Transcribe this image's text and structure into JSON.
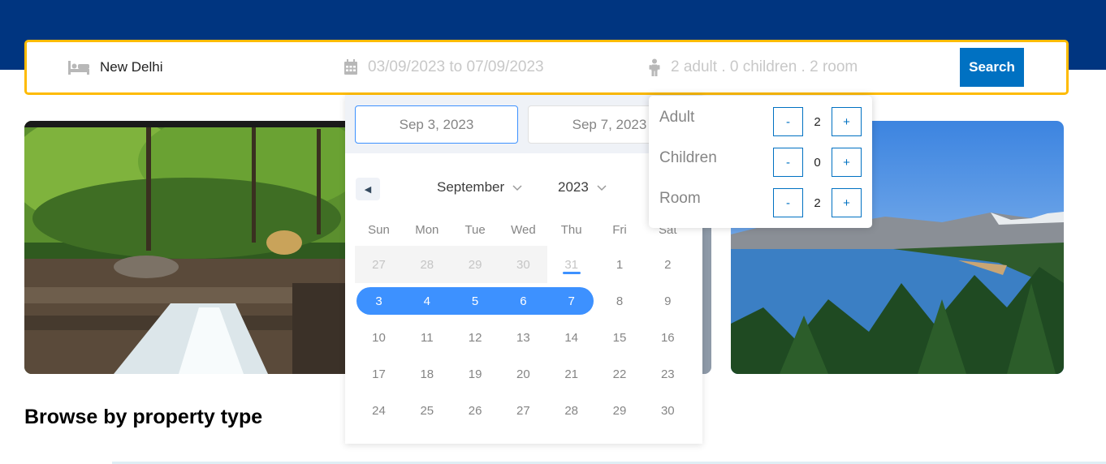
{
  "search": {
    "destination": "New Delhi",
    "dates": "03/09/2023 to 07/09/2023",
    "guests": "2 adult . 0 children . 2 room",
    "button": "Search"
  },
  "section_title": "Browse by property type",
  "datepicker": {
    "start_date": "Sep 3, 2023",
    "end_date": "Sep 7, 2023",
    "month": "September",
    "year": "2023",
    "weekdays": [
      "Sun",
      "Mon",
      "Tue",
      "Wed",
      "Thu",
      "Fri",
      "Sat"
    ],
    "weeks": [
      [
        "27",
        "28",
        "29",
        "30",
        "31",
        "1",
        "2"
      ],
      [
        "3",
        "4",
        "5",
        "6",
        "7",
        "8",
        "9"
      ],
      [
        "10",
        "11",
        "12",
        "13",
        "14",
        "15",
        "16"
      ],
      [
        "17",
        "18",
        "19",
        "20",
        "21",
        "22",
        "23"
      ],
      [
        "24",
        "25",
        "26",
        "27",
        "28",
        "29",
        "30"
      ]
    ]
  },
  "options": {
    "rows": [
      {
        "label": "Adult",
        "value": "2"
      },
      {
        "label": "Children",
        "value": "0"
      },
      {
        "label": "Room",
        "value": "2"
      }
    ],
    "minus": "-",
    "plus": "+"
  },
  "icons": {
    "destination": "bed-icon",
    "dates": "calendar-icon",
    "guests": "person-icon",
    "prev_month": "caret-left-icon",
    "dropdown": "chevron-down-icon"
  },
  "colors": {
    "header": "#003580",
    "search_border": "#febb02",
    "search_button": "#0071c2",
    "selection": "#3d91ff"
  }
}
